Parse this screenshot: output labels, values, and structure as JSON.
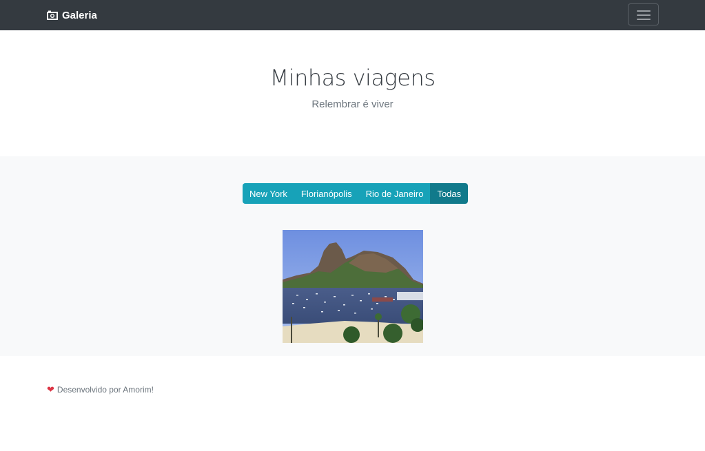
{
  "navbar": {
    "brand": "Galeria",
    "brand_icon": "camera-icon",
    "toggler_icon": "hamburger-menu-icon"
  },
  "hero": {
    "title": "Minhas viagens",
    "subtitle": "Relembrar é viver"
  },
  "filters": {
    "items": [
      {
        "label": "New York",
        "active": false
      },
      {
        "label": "Florianópolis",
        "active": false
      },
      {
        "label": "Rio de Janeiro",
        "active": false
      },
      {
        "label": "Todas",
        "active": true
      }
    ]
  },
  "gallery": {
    "photo_icon": "sugarloaf-mountain-photo"
  },
  "footer": {
    "heart_icon": "heart-icon",
    "text": "Desenvolvido por Amorim!"
  },
  "colors": {
    "navbar": "#343a40",
    "info": "#17a2b8",
    "info_active": "#117a8b",
    "section_bg": "#f8f9fa",
    "heart": "#dc3545"
  }
}
